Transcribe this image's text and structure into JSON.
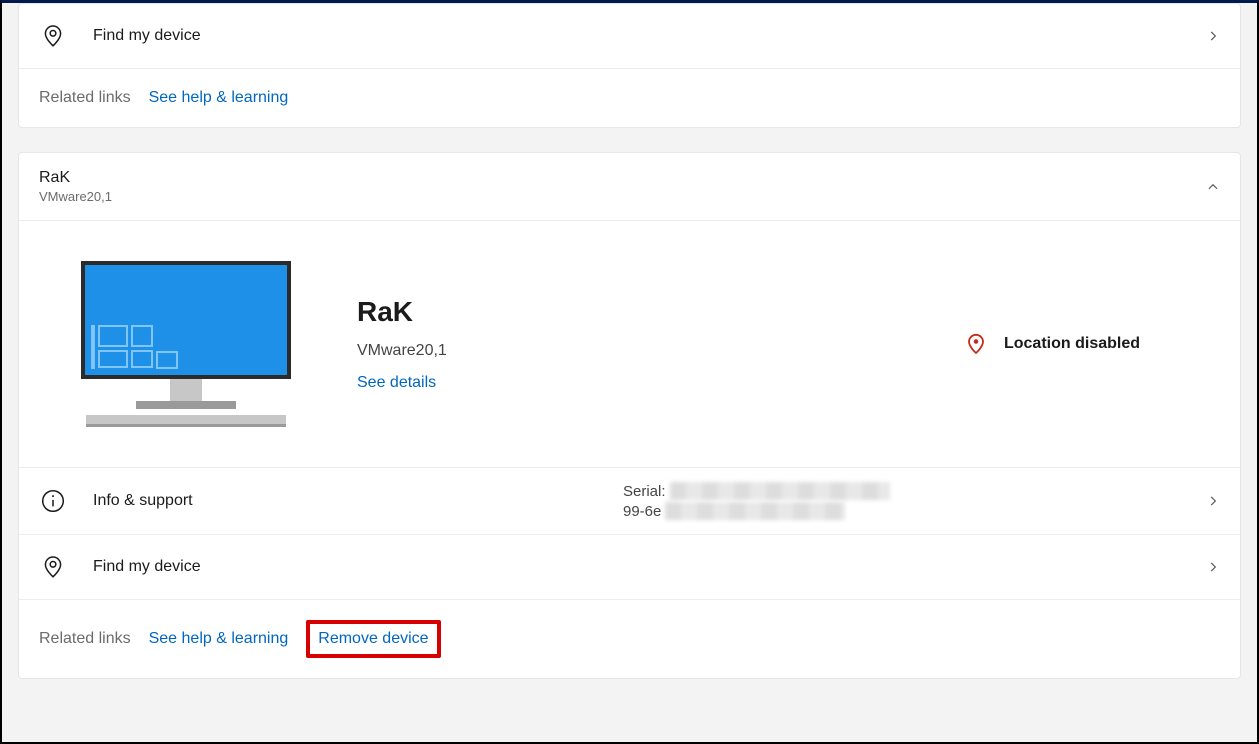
{
  "card1": {
    "findDevice": "Find my device",
    "relatedLinksLabel": "Related links",
    "helpLink": "See help & learning"
  },
  "device": {
    "name": "RaK",
    "model": "VMware20,1",
    "title": "RaK",
    "detailModel": "VMware20,1",
    "seeDetails": "See details",
    "locationStatus": "Location disabled",
    "infoSupport": "Info & support",
    "serialLabel": "Serial:",
    "serialPartial": "99-6e",
    "findDevice": "Find my device",
    "relatedLinksLabel": "Related links",
    "helpLink": "See help & learning",
    "removeDevice": "Remove device"
  }
}
